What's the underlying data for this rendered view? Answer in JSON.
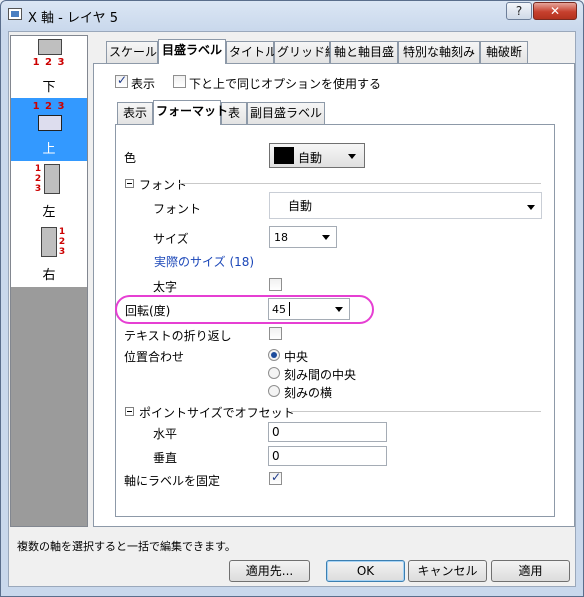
{
  "window": {
    "title": "X 軸 - レイヤ 5",
    "help_label": "?",
    "close_label": "✕"
  },
  "sidebar": {
    "items": [
      {
        "label": "下",
        "digits": "1 2 3"
      },
      {
        "label": "上",
        "digits": "1 2 3"
      },
      {
        "label": "左",
        "digits": [
          "1",
          "2",
          "3"
        ]
      },
      {
        "label": "右",
        "digits": [
          "1",
          "2",
          "3"
        ]
      }
    ],
    "selected_index": 1
  },
  "tabs": [
    "スケール",
    "目盛ラベル",
    "タイトル",
    "グリッド線",
    "軸と軸目盛",
    "特別な軸刻み",
    "軸破断"
  ],
  "active_tab": "目盛ラベル",
  "top_options": {
    "show_label": "表示",
    "show_checked": true,
    "same_options_label": "下と上で同じオプションを使用する",
    "same_checked": false
  },
  "subtabs": [
    "表示",
    "フォーマット",
    "表",
    "副目盛ラベル"
  ],
  "active_subtab": "フォーマット",
  "format": {
    "color_label": "色",
    "color_value": "自動",
    "color_swatch": "#000000",
    "font_section": "フォント",
    "font_label": "フォント",
    "font_value": "自動",
    "size_label": "サイズ",
    "size_value": "18",
    "actual_size_link": "実際のサイズ (18)",
    "bold_label": "太字",
    "bold_checked": false,
    "rotation_label": "回転(度)",
    "rotation_value": "45",
    "wrap_label": "テキストの折り返し",
    "wrap_checked": false,
    "align_label": "位置合わせ",
    "align_options": [
      "中央",
      "刻み間の中央",
      "刻みの横"
    ],
    "align_selected": 0,
    "offset_section": "ポイントサイズでオフセット",
    "horizontal_label": "水平",
    "horizontal_value": "0",
    "vertical_label": "垂直",
    "vertical_value": "0",
    "fix_label": "軸にラベルを固定",
    "fix_checked": true
  },
  "status_text": "複数の軸を選択すると一括で編集できます。",
  "buttons": {
    "apply_to": "適用先...",
    "ok": "OK",
    "cancel": "キャンセル",
    "apply": "適用"
  },
  "colors": {
    "highlight": "#e63fd3",
    "selection": "#3399ff"
  }
}
